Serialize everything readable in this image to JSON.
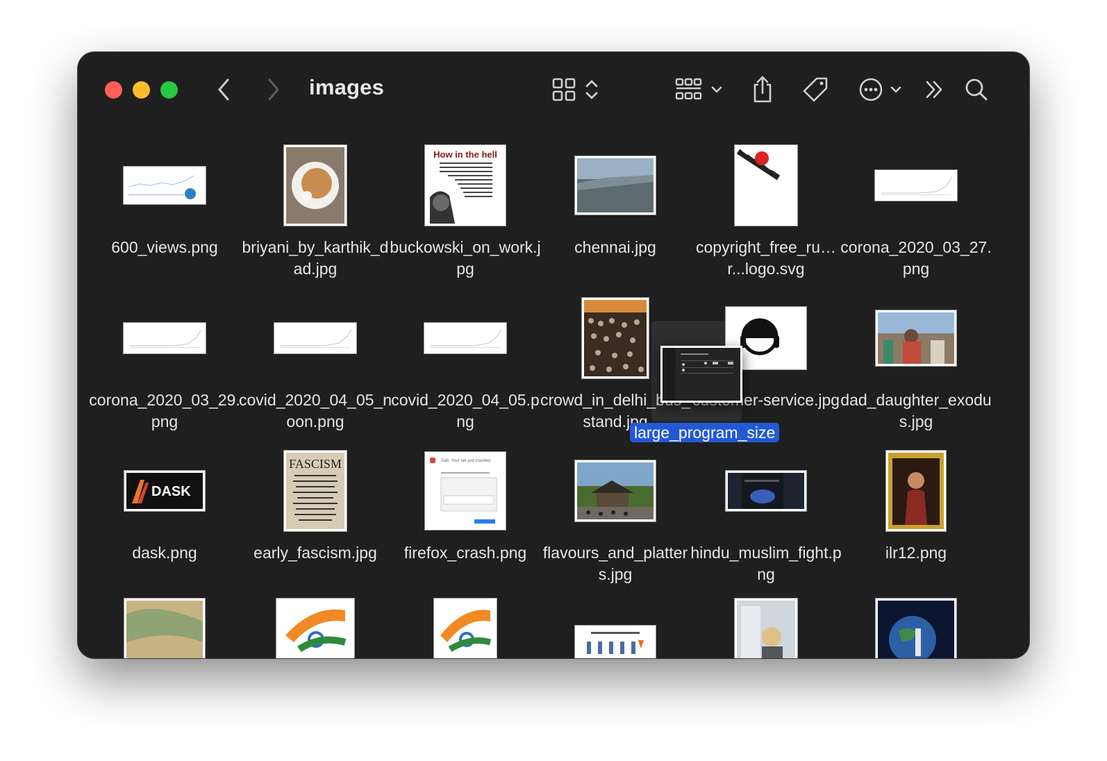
{
  "window": {
    "title": "images",
    "traffic_lights": [
      "close",
      "minimize",
      "zoom"
    ]
  },
  "toolbar": {
    "back_icon": "chevron-left-icon",
    "forward_icon": "chevron-right-icon",
    "view_icon": "grid-view-icon",
    "group_icon": "group-by-icon",
    "share_icon": "share-icon",
    "tag_icon": "tag-icon",
    "more_icon": "ellipsis-circle-icon",
    "overflow_icon": "double-chevron-icon",
    "search_icon": "search-icon"
  },
  "files": [
    {
      "name": "600_views.png"
    },
    {
      "name": "briyani_by_karthik_dad.jpg"
    },
    {
      "name": "buckowski_on_work.jpg",
      "thumb_text": "How in the hell"
    },
    {
      "name": "chennai.jpg"
    },
    {
      "name": "copyright_free_ru…r...logo.svg"
    },
    {
      "name": "corona_2020_03_27.png"
    },
    {
      "name": "corona_2020_03_29.png"
    },
    {
      "name": "covid_2020_04_05_noon.png"
    },
    {
      "name": "covid_2020_04_05.png"
    },
    {
      "name": "crowd_in_delhi_bus_stand.jpg"
    },
    {
      "name": "customer-service.jpg"
    },
    {
      "name": "dad_daughter_exodus.jpg"
    },
    {
      "name": "dask.png",
      "thumb_text": "DASK"
    },
    {
      "name": "early_fascism.jpg",
      "thumb_text": "FASCISM"
    },
    {
      "name": "firefox_crash.png",
      "thumb_text": "Gah. Your tab just crashed."
    },
    {
      "name": "flavours_and_platters.jpg"
    },
    {
      "name": "hindu_muslim_fight.png"
    },
    {
      "name": "ilr12.png"
    },
    {
      "name": ""
    },
    {
      "name": ""
    },
    {
      "name": ""
    },
    {
      "name": ""
    },
    {
      "name": ""
    },
    {
      "name": ""
    }
  ],
  "drag": {
    "name": "large_program_size"
  },
  "colors": {
    "window_bg": "#1f1f1f",
    "selection": "#2459d6",
    "red": "#ff5f57",
    "yellow": "#febc2e",
    "green": "#28c840"
  }
}
